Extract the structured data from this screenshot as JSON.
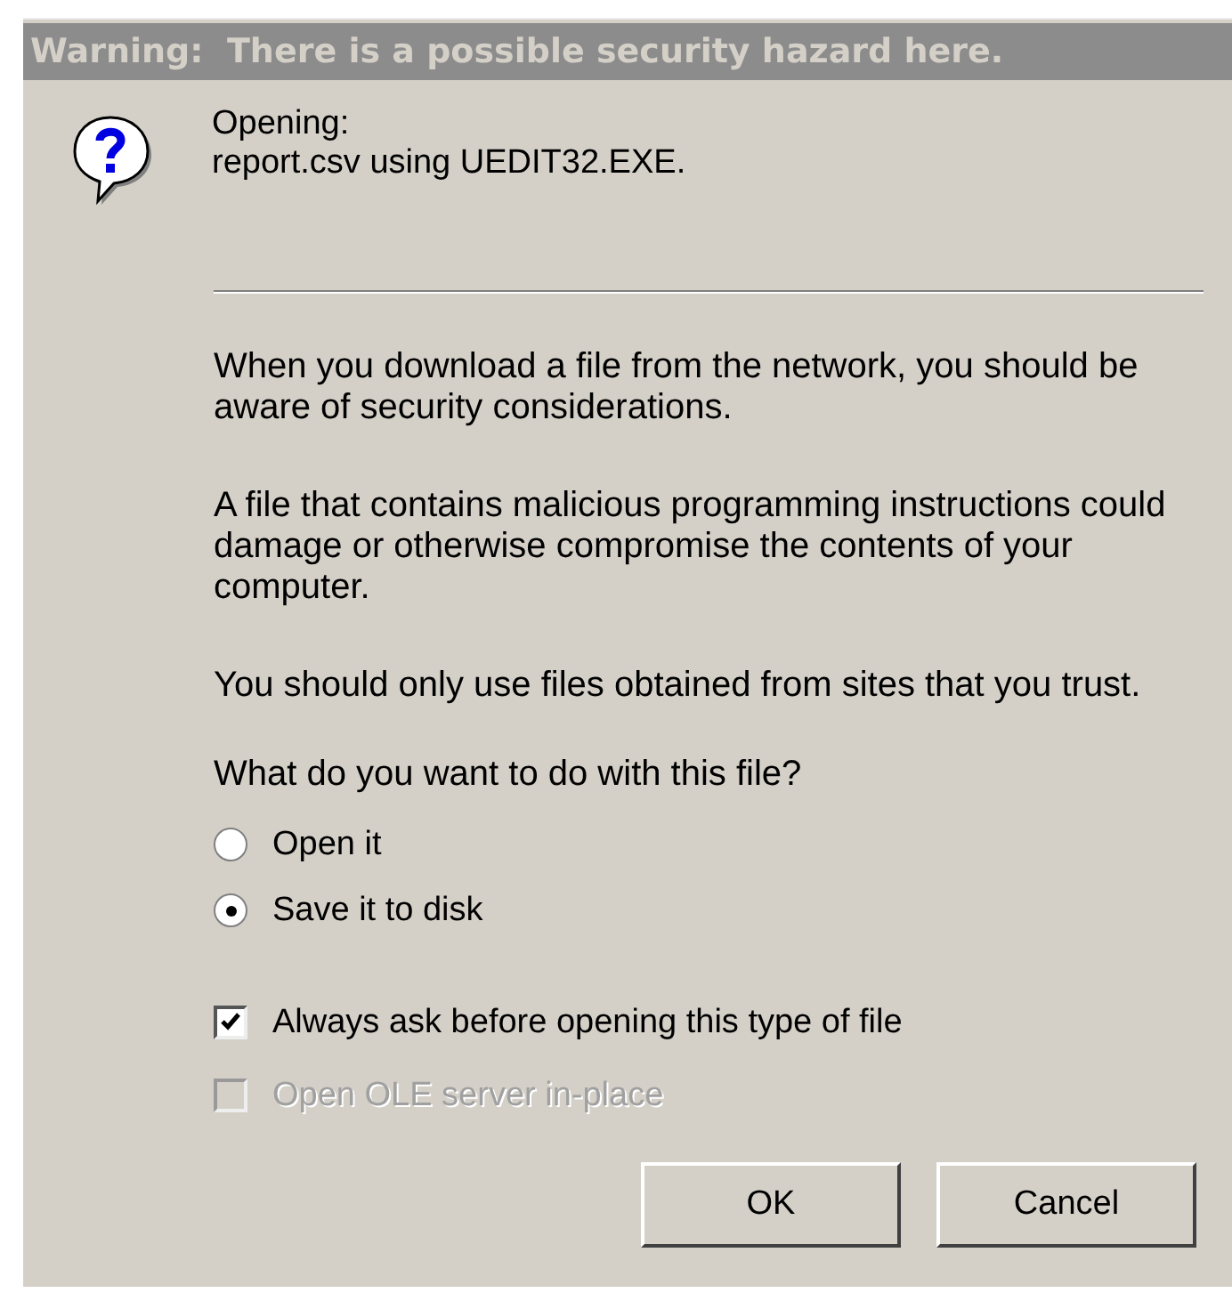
{
  "window": {
    "title": "Warning:  There is a possible security hazard here."
  },
  "header": {
    "label": "Opening:",
    "file": "report.csv using UEDIT32.EXE."
  },
  "paragraphs": [
    "When you download a file from the network, you should be aware of security considerations.",
    "A file that contains malicious programming instructions could damage or otherwise compromise the contents of your computer.",
    "You should only use files obtained from sites that you trust."
  ],
  "question": "What do you want to do with this file?",
  "options": [
    {
      "label": "Open it",
      "selected": false
    },
    {
      "label": "Save it to disk",
      "selected": true
    }
  ],
  "checkboxes": [
    {
      "label": "Always ask before opening this type of file",
      "checked": true,
      "disabled": false
    },
    {
      "label": "Open OLE server in-place",
      "checked": false,
      "disabled": true
    }
  ],
  "buttons": [
    {
      "label": "OK"
    },
    {
      "label": "Cancel"
    }
  ]
}
